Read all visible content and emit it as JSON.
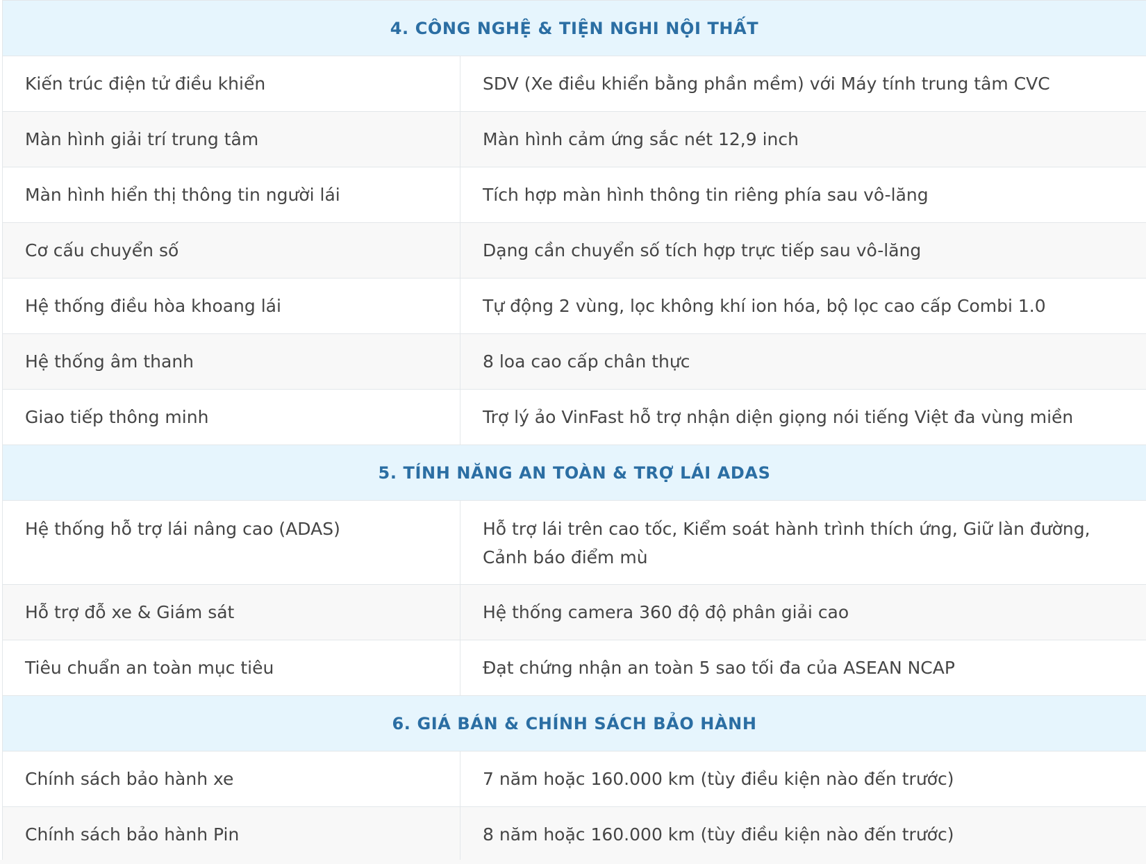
{
  "sections": [
    {
      "title": "4. CÔNG NGHỆ & TIỆN NGHI NỘI THẤT",
      "rows": [
        {
          "label": "Kiến trúc điện tử điều khiển",
          "value": "SDV (Xe điều khiển bằng phần mềm) với Máy tính trung tâm CVC"
        },
        {
          "label": "Màn hình giải trí trung tâm",
          "value": "Màn hình cảm ứng sắc nét 12,9 inch"
        },
        {
          "label": "Màn hình hiển thị thông tin người lái",
          "value": "Tích hợp màn hình thông tin riêng phía sau vô-lăng"
        },
        {
          "label": "Cơ cấu chuyển số",
          "value": "Dạng cần chuyển số tích hợp trực tiếp sau vô-lăng"
        },
        {
          "label": "Hệ thống điều hòa khoang lái",
          "value": "Tự động 2 vùng, lọc không khí ion hóa, bộ lọc cao cấp Combi 1.0"
        },
        {
          "label": "Hệ thống âm thanh",
          "value": "8 loa cao cấp chân thực"
        },
        {
          "label": "Giao tiếp thông minh",
          "value": "Trợ lý ảo VinFast hỗ trợ nhận diện giọng nói tiếng Việt đa vùng miền"
        }
      ]
    },
    {
      "title": "5. TÍNH NĂNG AN TOÀN & TRỢ LÁI ADAS",
      "rows": [
        {
          "label": "Hệ thống hỗ trợ lái nâng cao (ADAS)",
          "value": "Hỗ trợ lái trên cao tốc, Kiểm soát hành trình thích ứng, Giữ làn đường, Cảnh báo điểm mù"
        },
        {
          "label": "Hỗ trợ đỗ xe & Giám sát",
          "value": "Hệ thống camera 360 độ độ phân giải cao"
        },
        {
          "label": "Tiêu chuẩn an toàn mục tiêu",
          "value": "Đạt chứng nhận an toàn 5 sao tối đa của ASEAN NCAP"
        }
      ]
    },
    {
      "title": "6. GIÁ BÁN & CHÍNH SÁCH BẢO HÀNH",
      "rows": [
        {
          "label": "Chính sách bảo hành xe",
          "value": "7 năm hoặc 160.000 km (tùy điều kiện nào đến trước)"
        },
        {
          "label": "Chính sách bảo hành Pin",
          "value": "8 năm hoặc 160.000 km (tùy điều kiện nào đến trước)"
        }
      ]
    }
  ]
}
